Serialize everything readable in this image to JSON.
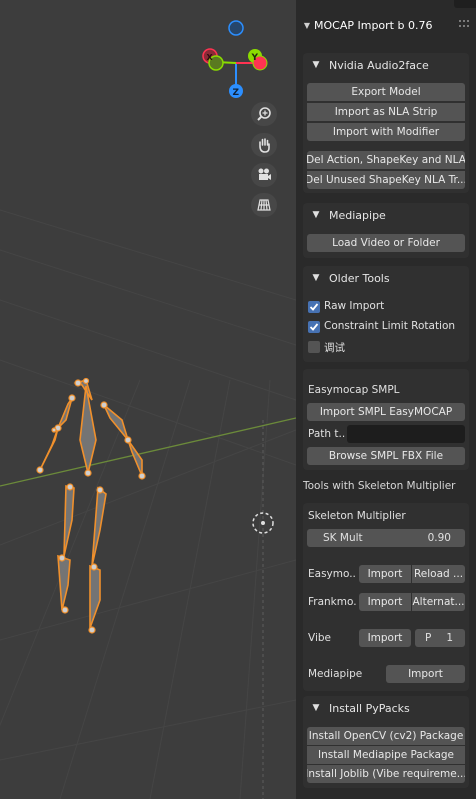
{
  "viewport": {
    "gizmo": {
      "x_label": "X",
      "y_label": "Y",
      "z_label": "Z"
    },
    "nav_icons": [
      "zoom-icon",
      "hand-pan-icon",
      "camera-icon",
      "grid-view-icon"
    ]
  },
  "panel": {
    "title": "MOCAP Import b 0.76",
    "nvidia": {
      "header": "Nvidia Audio2face",
      "export_model": "Export Model",
      "import_nla": "Import as NLA Strip",
      "import_modifier": "Import with Modifier",
      "del_action": "Del Action, ShapeKey and NLA",
      "del_unused": "Del Unused ShapeKey NLA Tr..."
    },
    "mediapipe": {
      "header": "Mediapipe",
      "load_video": "Load Video or Folder"
    },
    "older_tools": {
      "header": "Older Tools",
      "raw_import": "Raw Import",
      "raw_import_checked": true,
      "constraint_limit": "Constraint Limit Rotation",
      "constraint_limit_checked": true,
      "debug": "调试",
      "debug_checked": false
    },
    "easymocap": {
      "title": "Easymocap SMPL",
      "import_smpl": "Import SMPL EasyMOCAP",
      "path_label": "Path t...",
      "path_value": "",
      "browse": "Browse SMPL FBX File"
    },
    "skeleton_multiplier_heading": "Tools with Skeleton Multiplier",
    "skeleton": {
      "title": "Skeleton Multiplier",
      "sk_mult_label": "SK Mult",
      "sk_mult_value": "0.90",
      "rows": [
        {
          "label": "Easymo...",
          "import": "Import",
          "extra": "Reload ..."
        },
        {
          "label": "Frankmo...",
          "import": "Import",
          "extra": "Alternat..."
        },
        {
          "label": "Vibe",
          "import": "Import",
          "extra_label": "P",
          "extra_value": "1"
        },
        {
          "label": "Mediapipe",
          "import": "Import"
        }
      ]
    },
    "pypacks": {
      "header": "Install PyPacks",
      "opencv": "Install OpenCV (cv2) Package",
      "mediapipe": "Install Mediapipe Package",
      "joblib": "Install Joblib (Vibe requireme..."
    }
  },
  "colors": {
    "viewport_bg": "#3d3d3d",
    "panel_bg": "#2a2a2a",
    "section_bg": "#303030",
    "button": "#545454",
    "checkbox_on": "#4772b3",
    "bone_orange": "#f0902c",
    "axis_x": "#ff3352",
    "axis_y": "#8bdc00",
    "axis_z": "#2c8fff"
  }
}
